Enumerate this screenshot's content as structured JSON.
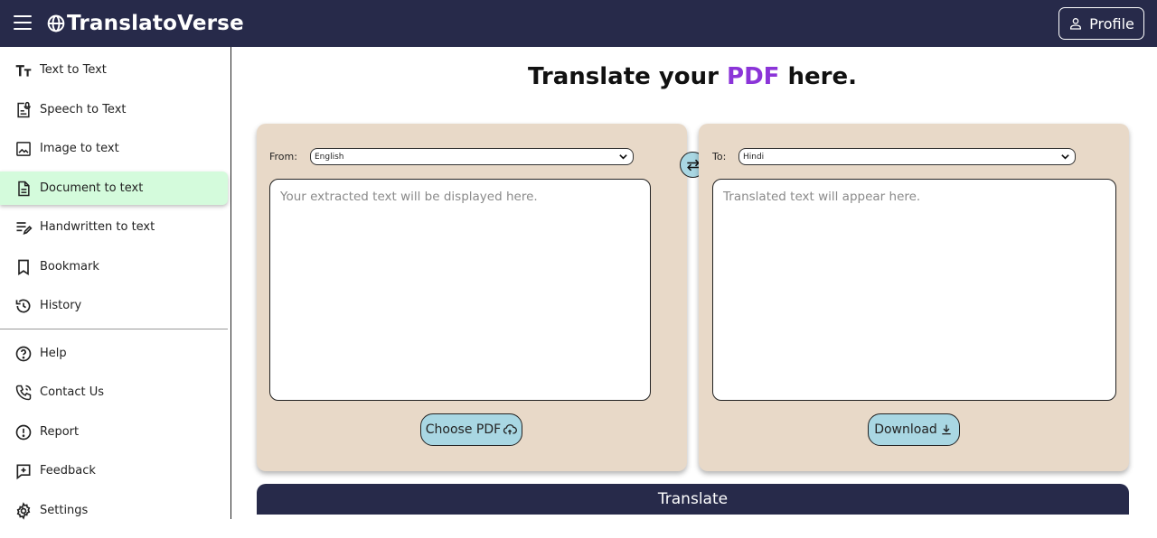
{
  "app": {
    "title": "TranslatoVerse"
  },
  "header": {
    "profile_label": "Profile"
  },
  "sidebar": {
    "items": [
      {
        "label": "Text to Text",
        "icon": "text-size-icon"
      },
      {
        "label": "Speech to Text",
        "icon": "speech-doc-icon"
      },
      {
        "label": "Image to text",
        "icon": "image-icon"
      },
      {
        "label": "Document to text",
        "icon": "document-icon",
        "active": true
      },
      {
        "label": "Handwritten to text",
        "icon": "handwriting-icon"
      },
      {
        "label": "Bookmark",
        "icon": "bookmark-icon"
      },
      {
        "label": "History",
        "icon": "history-icon"
      }
    ],
    "secondary_items": [
      {
        "label": "Help",
        "icon": "help-icon"
      },
      {
        "label": "Contact Us",
        "icon": "phone-icon"
      },
      {
        "label": "Report",
        "icon": "report-icon"
      },
      {
        "label": "Feedback",
        "icon": "feedback-icon"
      },
      {
        "label": "Settings",
        "icon": "gear-icon"
      }
    ]
  },
  "main": {
    "title_pre": "Translate your ",
    "title_accent": "PDF",
    "title_post": " here.",
    "source": {
      "label": "From:",
      "language": "English",
      "placeholder": "Your extracted text will be displayed here.",
      "button_label": "Choose PDF"
    },
    "target": {
      "label": "To:",
      "language": "Hindi",
      "placeholder": "Translated text will appear here.",
      "button_label": "Download"
    },
    "translate_label": "Translate"
  },
  "colors": {
    "header_bg": "#272a4a",
    "accent_purple": "#8b34d8",
    "panel_bg": "#e8d9c8",
    "button_bg": "#a9d7e3",
    "active_nav_bg": "#d4fbdc"
  }
}
